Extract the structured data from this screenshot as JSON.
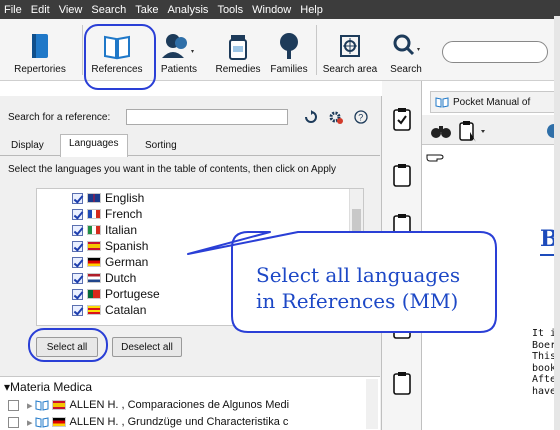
{
  "menu": [
    "File",
    "Edit",
    "View",
    "Search",
    "Take",
    "Analysis",
    "Tools",
    "Window",
    "Help"
  ],
  "toolbar": {
    "repertories": "Repertories",
    "references": "References",
    "patients": "Patients",
    "remedies": "Remedies",
    "families": "Families",
    "search_area": "Search area",
    "search": "Search"
  },
  "left": {
    "search_label": "Search for a reference:",
    "tabs": [
      "Display",
      "Languages",
      "Sorting"
    ],
    "instruction": "Select the languages you want in the table of contents, then click on Apply",
    "languages": [
      "English",
      "French",
      "Italian",
      "Spanish",
      "German",
      "Dutch",
      "Portugese",
      "Catalan"
    ],
    "select_all": "Select all",
    "deselect_all": "Deselect all",
    "mm_title": "Materia Medica",
    "mm_items": [
      "ALLEN H. , Comparaciones de Algunos Medi",
      "ALLEN H. , Grundzüge und Characteristika c"
    ]
  },
  "right": {
    "tab_title": "Pocket Manual of",
    "big_letter": "B",
    "paragraph": [
      "It is ou",
      "Boerick",
      "This bo",
      "book f",
      "After p",
      "have d"
    ]
  },
  "callout": {
    "line1": "Select all languages",
    "line2": "in References (MM)"
  },
  "colors": {
    "annotation": "#2a3fd6",
    "menubar": "#3c3c3c"
  }
}
